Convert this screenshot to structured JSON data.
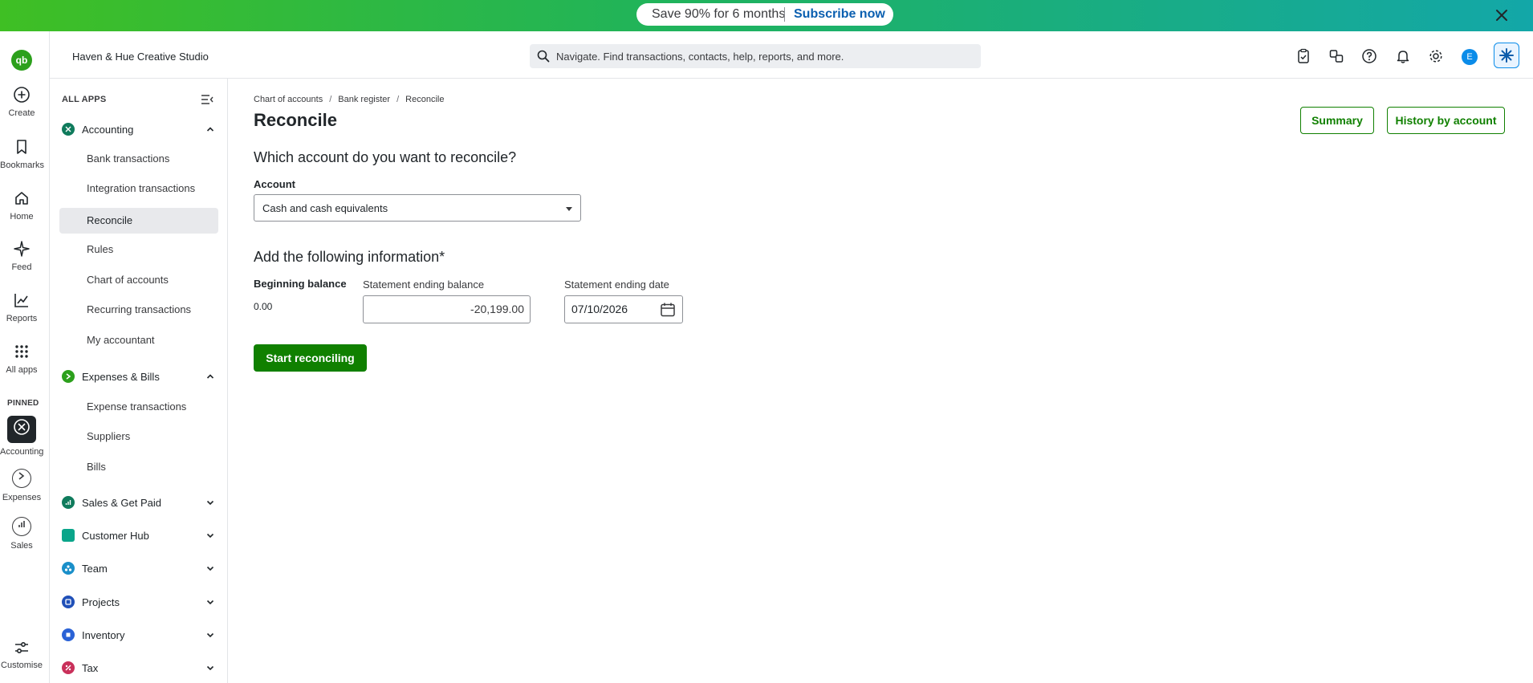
{
  "banner": {
    "promo_text": "Save 90% for 6 months",
    "cta_label": "Subscribe now"
  },
  "rail": {
    "logo": "qb",
    "items": [
      {
        "label": "Create",
        "icon": "plus-circle-icon"
      },
      {
        "label": "Bookmarks",
        "icon": "bookmark-icon"
      },
      {
        "label": "Home",
        "icon": "home-icon"
      },
      {
        "label": "Feed",
        "icon": "sparkle-icon"
      },
      {
        "label": "Reports",
        "icon": "chart-line-icon"
      },
      {
        "label": "All apps",
        "icon": "grid-icon"
      }
    ],
    "pinned_label": "PINNED",
    "pinned": [
      {
        "label": "Accounting",
        "icon": "accounting-icon"
      },
      {
        "label": "Expenses",
        "icon": "expenses-icon"
      },
      {
        "label": "Sales",
        "icon": "sales-icon"
      }
    ],
    "customise_label": "Customise"
  },
  "header": {
    "company_name": "Haven & Hue Creative Studio",
    "search_placeholder": "Navigate. Find transactions, contacts, help, reports, and more.",
    "avatar_initial": "E"
  },
  "sidebar": {
    "all_apps_label": "ALL APPS",
    "groups": [
      {
        "label": "Accounting",
        "color": "#0f7b5c"
      },
      {
        "label": "Expenses & Bills",
        "color": "#2ca01c"
      },
      {
        "label": "Sales & Get Paid",
        "color": "#0f7b5c"
      },
      {
        "label": "Customer Hub",
        "color": "#0aa58a"
      },
      {
        "label": "Team",
        "color": "#1a8fc9"
      },
      {
        "label": "Projects",
        "color": "#2050b8"
      },
      {
        "label": "Inventory",
        "color": "#2a62d6"
      },
      {
        "label": "Tax",
        "color": "#c9305a"
      }
    ],
    "accounting_items": [
      "Bank transactions",
      "Integration transactions",
      "Reconcile",
      "Rules",
      "Chart of accounts",
      "Recurring transactions",
      "My accountant"
    ],
    "expenses_items": [
      "Expense transactions",
      "Suppliers",
      "Bills"
    ]
  },
  "main": {
    "breadcrumb": [
      "Chart of accounts",
      "Bank register",
      "Reconcile"
    ],
    "title": "Reconcile",
    "summary_label": "Summary",
    "history_label": "History by account",
    "question_account": "Which account do you want to reconcile?",
    "account_label": "Account",
    "account_value": "Cash and cash equivalents",
    "info_heading": "Add the following information*",
    "beginning_balance_label": "Beginning balance",
    "beginning_balance_value": "0.00",
    "ending_balance_label": "Statement ending balance",
    "ending_balance_value": "-20,199.00",
    "ending_date_label": "Statement ending date",
    "ending_date_value": "07/10/2026",
    "start_label": "Start reconciling"
  },
  "colors": {
    "brand_green": "#2ca01c",
    "button_green": "#108000",
    "accent_blue": "#0b8ce9"
  }
}
